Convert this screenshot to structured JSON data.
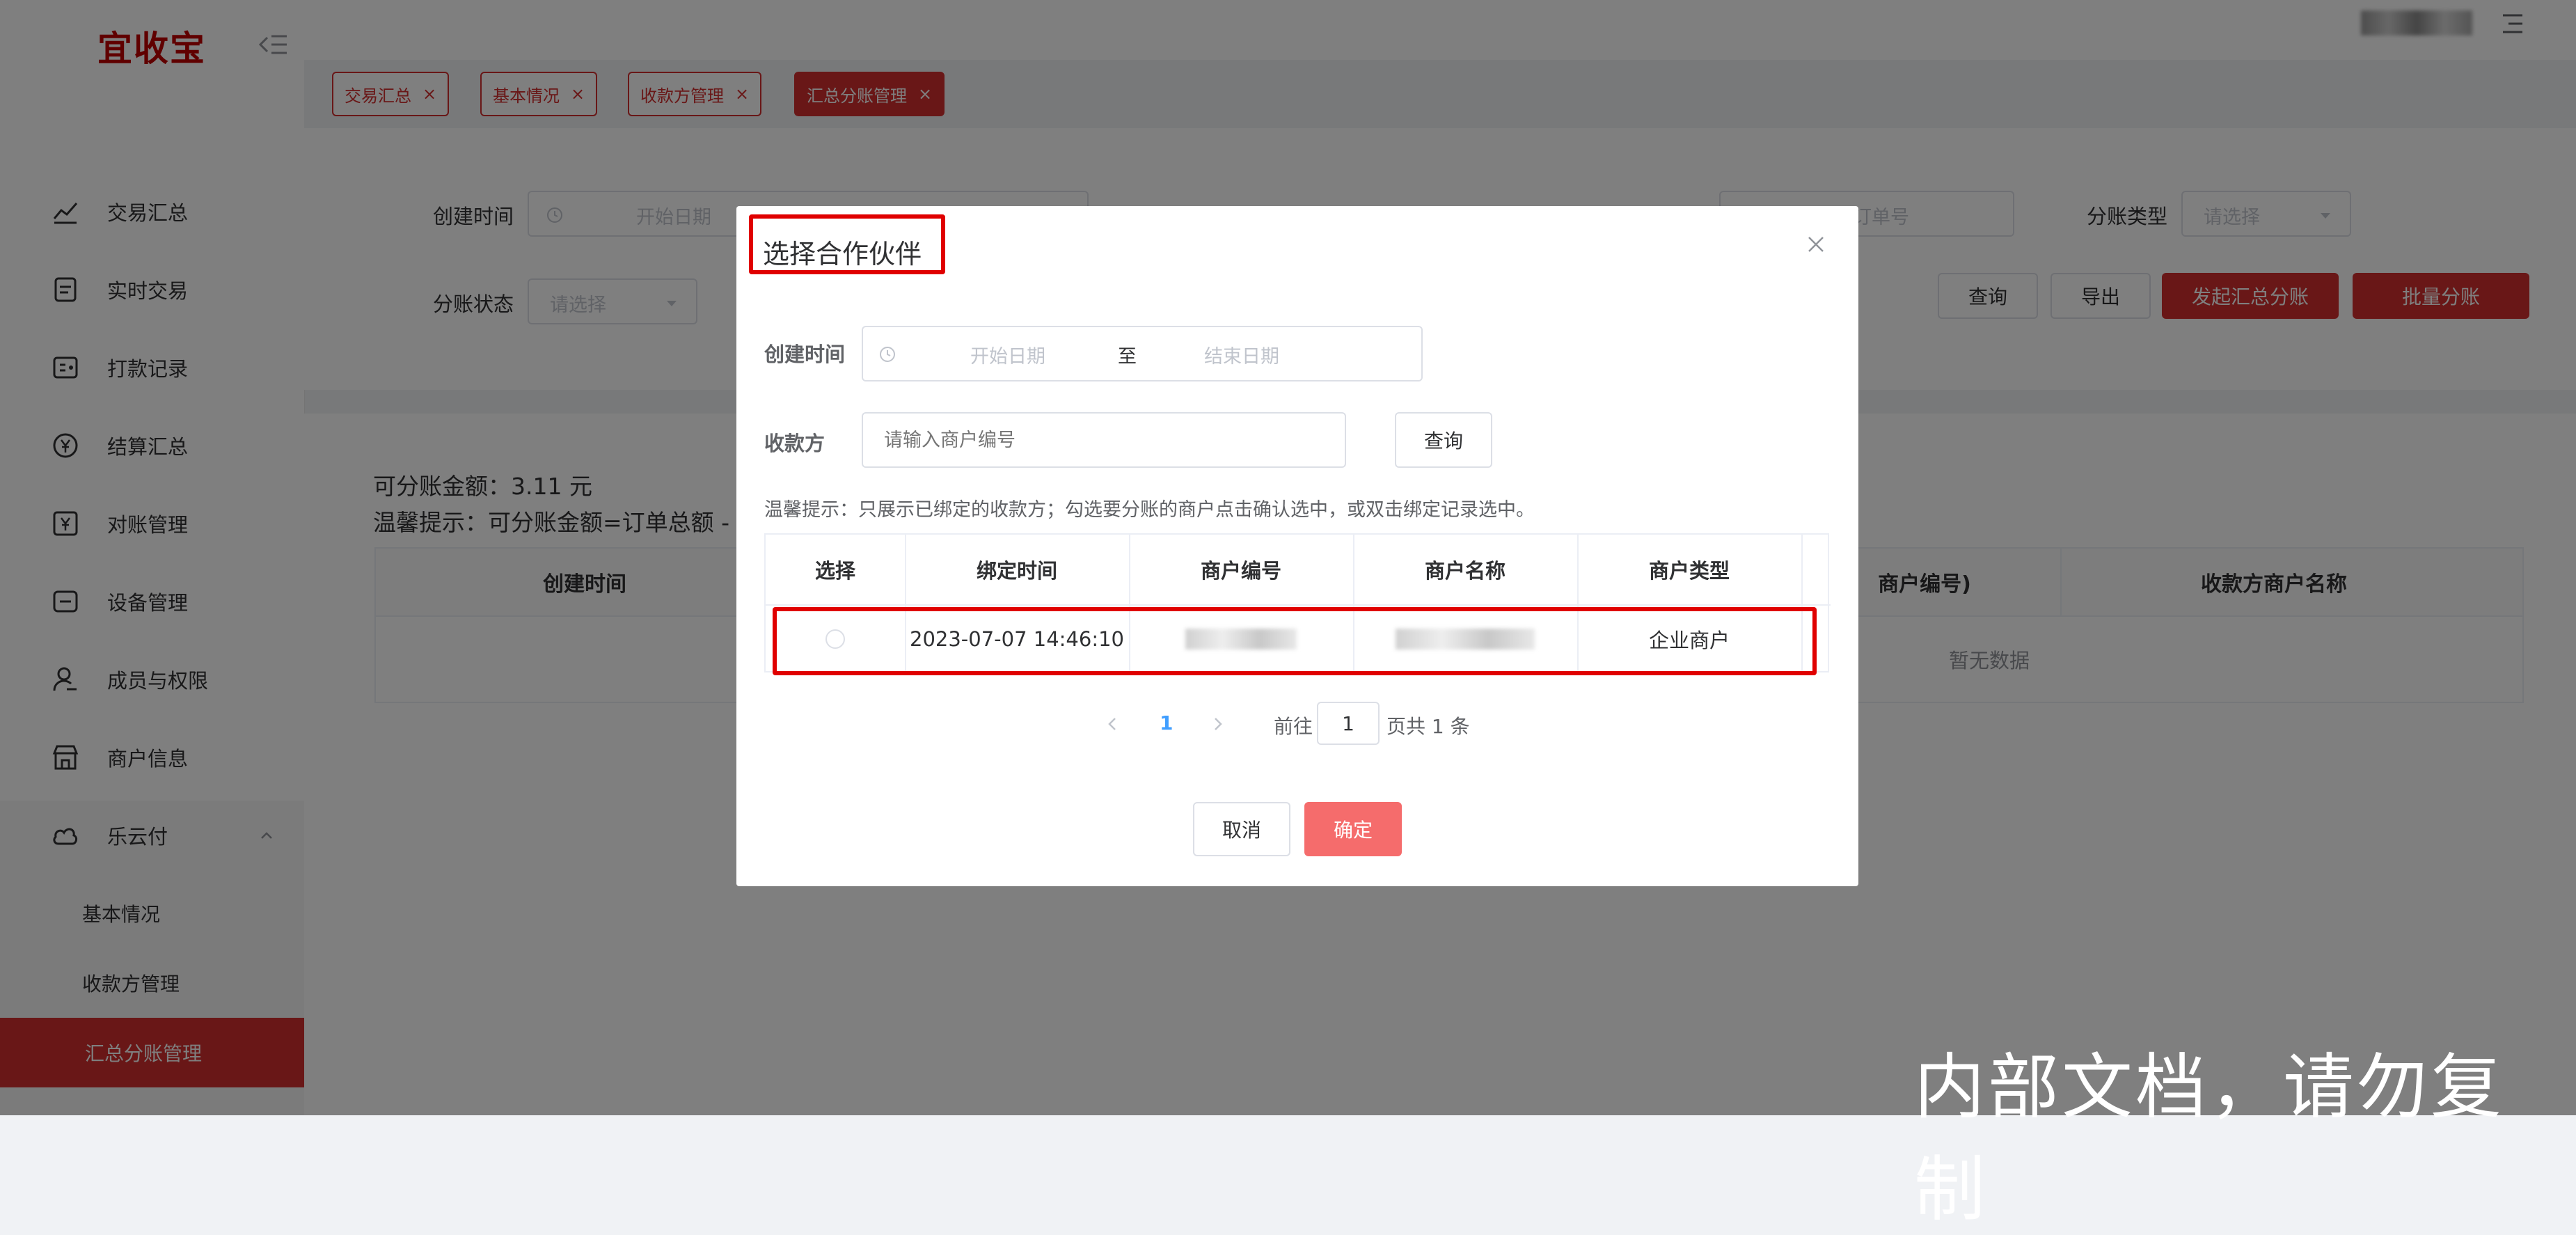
{
  "app": {
    "logo": "宜收宝"
  },
  "sidebar": {
    "items": [
      {
        "label": "交易汇总",
        "icon": "trend-chart-icon"
      },
      {
        "label": "实时交易",
        "icon": "document-icon"
      },
      {
        "label": "打款记录",
        "icon": "record-icon"
      },
      {
        "label": "结算汇总",
        "icon": "yen-circle-icon"
      },
      {
        "label": "对账管理",
        "icon": "yen-square-icon"
      },
      {
        "label": "设备管理",
        "icon": "device-icon"
      },
      {
        "label": "成员与权限",
        "icon": "user-key-icon"
      },
      {
        "label": "商户信息",
        "icon": "shop-icon"
      },
      {
        "label": "乐云付",
        "icon": "cloud-icon"
      }
    ],
    "submenu": [
      {
        "label": "基本情况"
      },
      {
        "label": "收款方管理"
      },
      {
        "label": "汇总分账管理"
      }
    ]
  },
  "tabs": [
    {
      "label": "交易汇总"
    },
    {
      "label": "基本情况"
    },
    {
      "label": "收款方管理"
    },
    {
      "label": "汇总分账管理"
    }
  ],
  "filters": {
    "create_time_label": "创建时间",
    "start_date_ph": "开始日期",
    "order_no_ph": "订单号",
    "split_type_label": "分账类型",
    "split_type_ph": "请选择",
    "split_status_label": "分账状态",
    "split_status_ph": "请选择"
  },
  "actions": {
    "query": "查询",
    "export": "导出",
    "start_summary": "发起汇总分账",
    "batch_split": "批量分账"
  },
  "info": {
    "amount_line": "可分账金额：3.11 元",
    "tip_line": "温馨提示：可分账金额=订单总额 - 手"
  },
  "main_table": {
    "headers": {
      "create_time": "创建时间",
      "merchant_no": "商户编号)",
      "payee_name": "收款方商户名称"
    },
    "empty": "暂无数据"
  },
  "dialog": {
    "title": "选择合作伙伴",
    "create_time_label": "创建时间",
    "start_ph": "开始日期",
    "to": "至",
    "end_ph": "结束日期",
    "payee_label": "收款方",
    "payee_ph": "请输入商户编号",
    "query": "查询",
    "tip": "温馨提示：只展示已绑定的收款方；勾选要分账的商户点击确认选中，或双击绑定记录选中。",
    "headers": {
      "select": "选择",
      "bind_time": "绑定时间",
      "merchant_no": "商户编号",
      "merchant_name": "商户名称",
      "merchant_type": "商户类型"
    },
    "rows": [
      {
        "bind_time": "2023-07-07 14:46:10",
        "merchant_type": "企业商户"
      }
    ],
    "pager": {
      "page": "1",
      "goto": "前往",
      "goto_value": "1",
      "suffix": "页共 1 条"
    },
    "cancel": "取消",
    "confirm": "确定"
  },
  "watermark": "内部文档，请勿复制",
  "colors": {
    "brand": "#d32f2f",
    "highlight": "#e00000",
    "link": "#409eff"
  }
}
